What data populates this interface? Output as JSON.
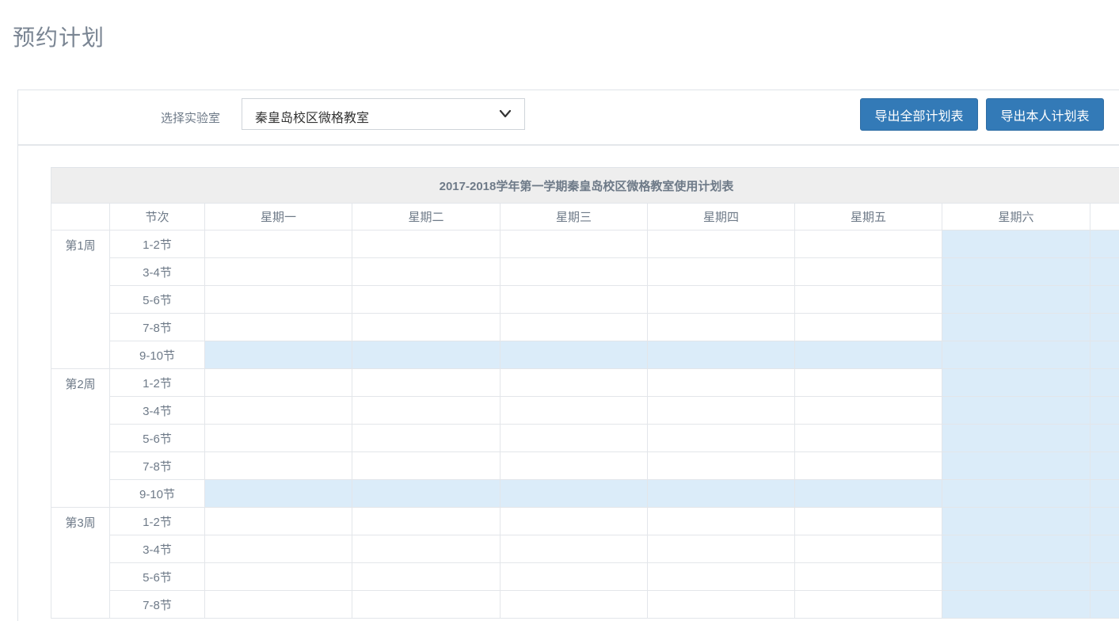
{
  "page": {
    "title": "预约计划"
  },
  "toolbar": {
    "lab_label": "选择实验室",
    "lab_selected": "秦皇岛校区微格教室",
    "export_all_label": "导出全部计划表",
    "export_mine_label": "导出本人计划表"
  },
  "schedule": {
    "caption": "2017-2018学年第一学期秦皇岛校区微格教室使用计划表",
    "slot_header": "节次",
    "days": [
      "星期一",
      "星期二",
      "星期三",
      "星期四",
      "星期五",
      "星期六"
    ],
    "weeks": [
      {
        "label": "第1周",
        "slots": [
          "1-2节",
          "3-4节",
          "5-6节",
          "7-8节",
          "9-10节"
        ]
      },
      {
        "label": "第2周",
        "slots": [
          "1-2节",
          "3-4节",
          "5-6节",
          "7-8节",
          "9-10节"
        ]
      },
      {
        "label": "第3周",
        "slots": [
          "1-2节",
          "3-4节",
          "5-6节",
          "7-8节"
        ]
      }
    ]
  },
  "colors": {
    "primary_button": "#337ab7",
    "highlight_cell": "#dbecf9",
    "caption_bg": "#eeeeee"
  },
  "icons": {
    "select_chevron": "chevron-down-icon"
  }
}
